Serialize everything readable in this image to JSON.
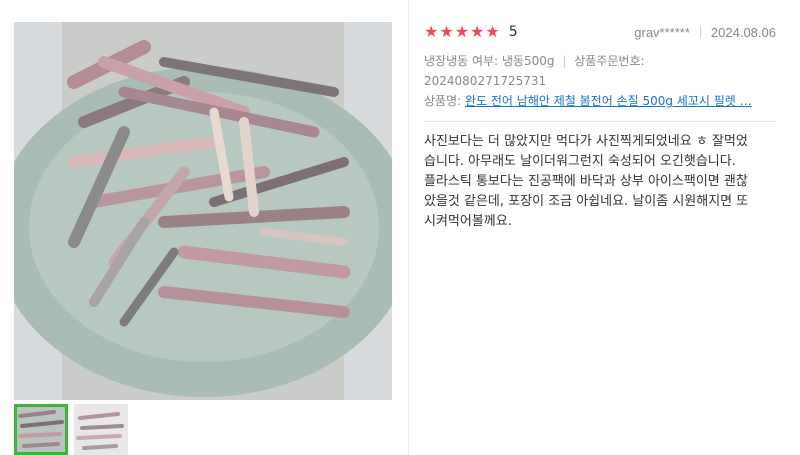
{
  "gallery": {
    "main_image_icon": "dried-fish-fillets-on-plate-photo",
    "thumbnails": [
      {
        "icon": "fish-fillets-photo-thumb",
        "active": true
      },
      {
        "icon": "fish-fillets-photo-thumb",
        "active": false
      }
    ],
    "active_color": "#40b33a"
  },
  "review": {
    "rating_stars": 5,
    "rating_value": "5",
    "star_color": "#f2495a",
    "reviewer": "grav******",
    "date": "2024.08.06",
    "option_label": "냉장냉동 여부:",
    "option_value": "냉동500g",
    "order_no_label": "상품주문번호:",
    "order_no_value": "2024080271725731",
    "product_label": "상품명:",
    "product_name": "완도 전어 남해안 제철 봄전어 손질 500g 세꼬시 필렛 …",
    "link_color": "#1a73c8",
    "text_lines": [
      "사진보다는 더 많았지만 먹다가 사진찍게되었네요 ㅎ 잘먹었",
      "습니다. 아무래도 날이더워그런지 숙성되어 오긴햇습니다.",
      "플라스틱 통보다는 진공팩에 바닥과 상부 아이스팩이면 괜찮",
      "았을것 같은데, 포장이 조금 아쉽네요. 날이좀 시원해지면 또",
      "시켜먹어볼께요."
    ]
  }
}
